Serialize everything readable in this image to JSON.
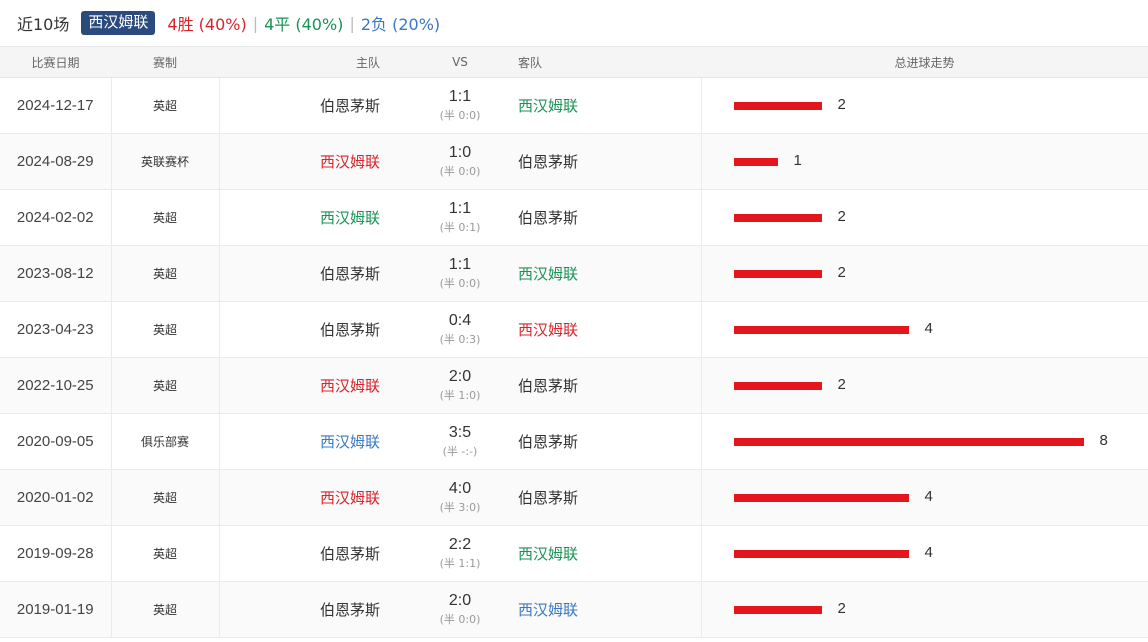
{
  "header": {
    "label": "近10场",
    "team_badge": "西汉姆联",
    "wins": "4胜 (40%)",
    "draws": "4平 (40%)",
    "losses": "2负 (20%)",
    "separator": "|"
  },
  "columns": {
    "date": "比赛日期",
    "competition": "赛制",
    "home": "主队",
    "vs": "VS",
    "away": "客队",
    "trend": "总进球走势"
  },
  "colors": {
    "win": "#d9232a",
    "draw": "#199355",
    "loss": "#3a78c3",
    "bar": "#e3161d",
    "badge": "#2b4a7d"
  },
  "matches": [
    {
      "date": "2024-12-17",
      "comp": "英超",
      "home": "伯恩茅斯",
      "home_color": "dark",
      "ft": "1:1",
      "ht": "(半 0:0)",
      "away": "西汉姆联",
      "away_color": "green",
      "goals": 2
    },
    {
      "date": "2024-08-29",
      "comp": "英联赛杯",
      "home": "西汉姆联",
      "home_color": "red",
      "ft": "1:0",
      "ht": "(半 0:0)",
      "away": "伯恩茅斯",
      "away_color": "dark",
      "goals": 1
    },
    {
      "date": "2024-02-02",
      "comp": "英超",
      "home": "西汉姆联",
      "home_color": "green",
      "ft": "1:1",
      "ht": "(半 0:1)",
      "away": "伯恩茅斯",
      "away_color": "dark",
      "goals": 2
    },
    {
      "date": "2023-08-12",
      "comp": "英超",
      "home": "伯恩茅斯",
      "home_color": "dark",
      "ft": "1:1",
      "ht": "(半 0:0)",
      "away": "西汉姆联",
      "away_color": "green",
      "goals": 2
    },
    {
      "date": "2023-04-23",
      "comp": "英超",
      "home": "伯恩茅斯",
      "home_color": "dark",
      "ft": "0:4",
      "ht": "(半 0:3)",
      "away": "西汉姆联",
      "away_color": "red",
      "goals": 4
    },
    {
      "date": "2022-10-25",
      "comp": "英超",
      "home": "西汉姆联",
      "home_color": "red",
      "ft": "2:0",
      "ht": "(半 1:0)",
      "away": "伯恩茅斯",
      "away_color": "dark",
      "goals": 2
    },
    {
      "date": "2020-09-05",
      "comp": "俱乐部赛",
      "home": "西汉姆联",
      "home_color": "blue",
      "ft": "3:5",
      "ht": "(半 -:-)",
      "away": "伯恩茅斯",
      "away_color": "dark",
      "goals": 8
    },
    {
      "date": "2020-01-02",
      "comp": "英超",
      "home": "西汉姆联",
      "home_color": "red",
      "ft": "4:0",
      "ht": "(半 3:0)",
      "away": "伯恩茅斯",
      "away_color": "dark",
      "goals": 4
    },
    {
      "date": "2019-09-28",
      "comp": "英超",
      "home": "伯恩茅斯",
      "home_color": "dark",
      "ft": "2:2",
      "ht": "(半 1:1)",
      "away": "西汉姆联",
      "away_color": "green",
      "goals": 4
    },
    {
      "date": "2019-01-19",
      "comp": "英超",
      "home": "伯恩茅斯",
      "home_color": "dark",
      "ft": "2:0",
      "ht": "(半 0:0)",
      "away": "西汉姆联",
      "away_color": "blue",
      "goals": 2
    }
  ]
}
